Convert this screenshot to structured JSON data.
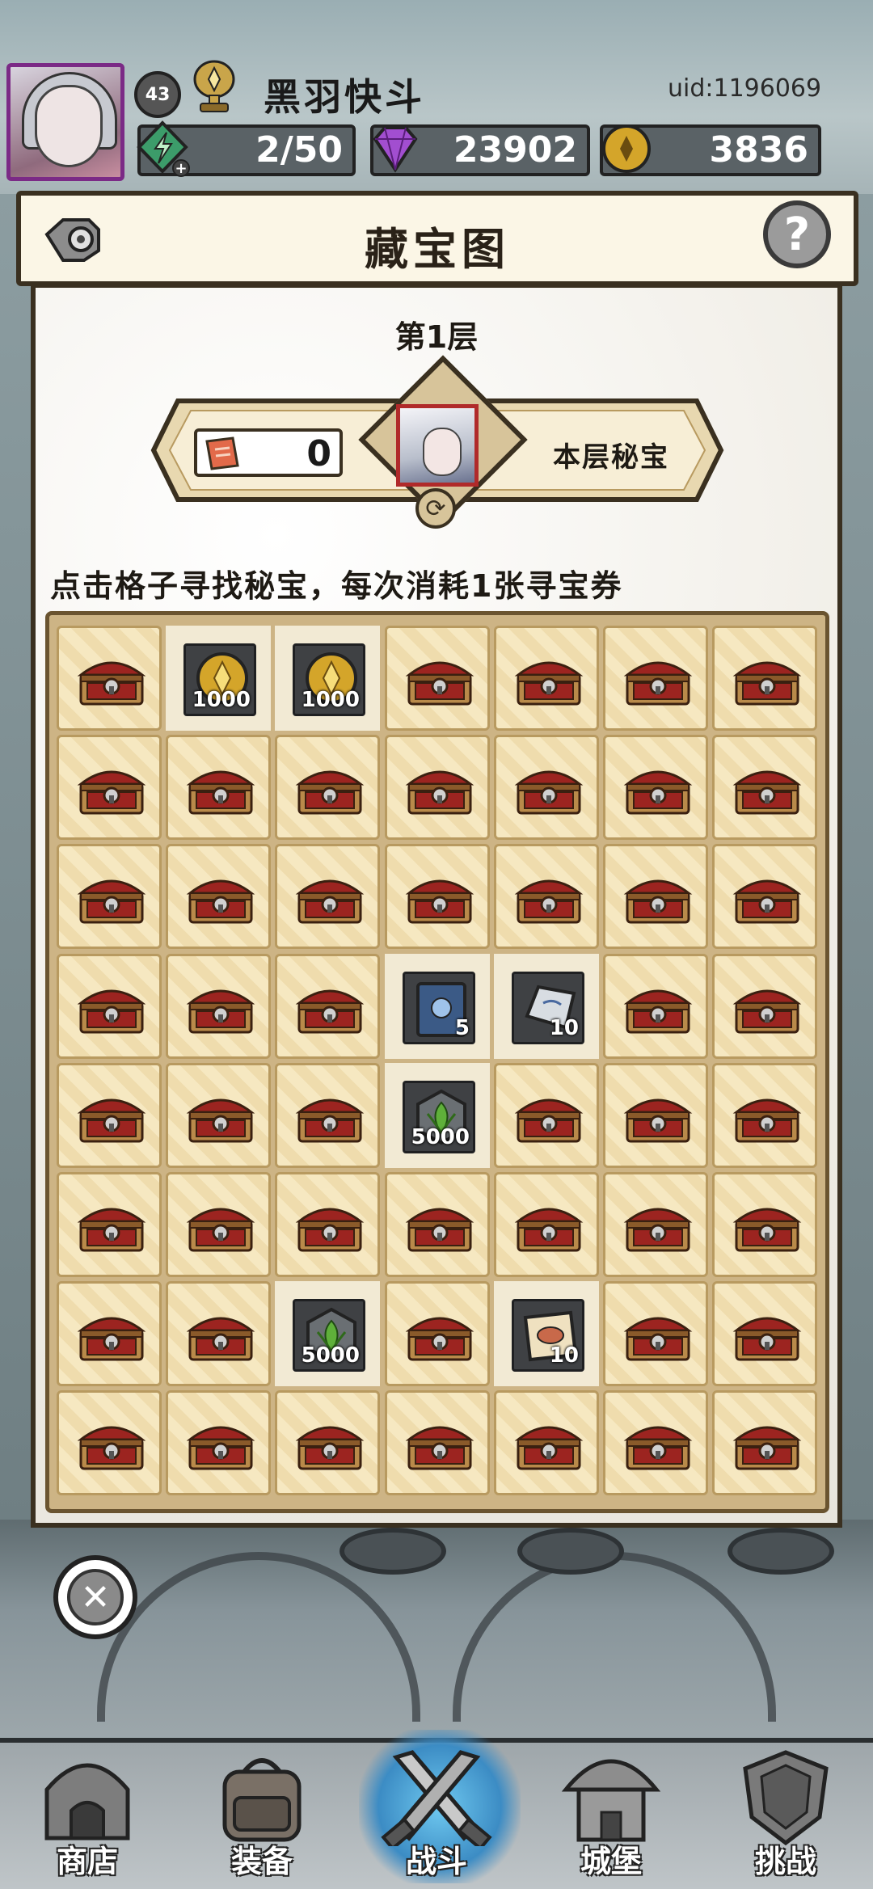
{
  "header": {
    "level": "43",
    "player_name": "黑羽快斗",
    "uid": "uid:1196069",
    "energy": "2/50",
    "gems": "23902",
    "gold": "3836"
  },
  "panel": {
    "title": "藏宝图",
    "help_label": "?",
    "floor": "第1层",
    "ticket_count": "0",
    "secret_label": "本层秘宝",
    "instructions": "点击格子寻找秘宝，每次消耗1张寻宝券"
  },
  "grid": {
    "rows": 8,
    "cols": 7,
    "revealed": [
      {
        "row": 0,
        "col": 1,
        "icon": "gold-coin-icon",
        "amount": "1000"
      },
      {
        "row": 0,
        "col": 2,
        "icon": "gold-coin-icon",
        "amount": "1000"
      },
      {
        "row": 3,
        "col": 3,
        "icon": "skill-book-icon",
        "amount": "5"
      },
      {
        "row": 3,
        "col": 4,
        "icon": "silver-ingot-icon",
        "amount": "10"
      },
      {
        "row": 4,
        "col": 3,
        "icon": "green-essence-icon",
        "amount": "5000"
      },
      {
        "row": 6,
        "col": 2,
        "icon": "green-essence-icon",
        "amount": "5000"
      },
      {
        "row": 6,
        "col": 4,
        "icon": "treasure-map-icon",
        "amount": "10"
      }
    ]
  },
  "nav": {
    "items": [
      {
        "label": "商店",
        "icon": "shop-icon"
      },
      {
        "label": "装备",
        "icon": "backpack-icon"
      },
      {
        "label": "战斗",
        "icon": "crossed-swords-icon",
        "active": true
      },
      {
        "label": "城堡",
        "icon": "castle-icon"
      },
      {
        "label": "挑战",
        "icon": "shield-helmet-icon"
      }
    ]
  },
  "colors": {
    "panel_bg": "#f4f1ea",
    "tile_light": "#f6e8c1",
    "chest_red": "#9c2420",
    "active_glow": "#3c8cc4"
  }
}
